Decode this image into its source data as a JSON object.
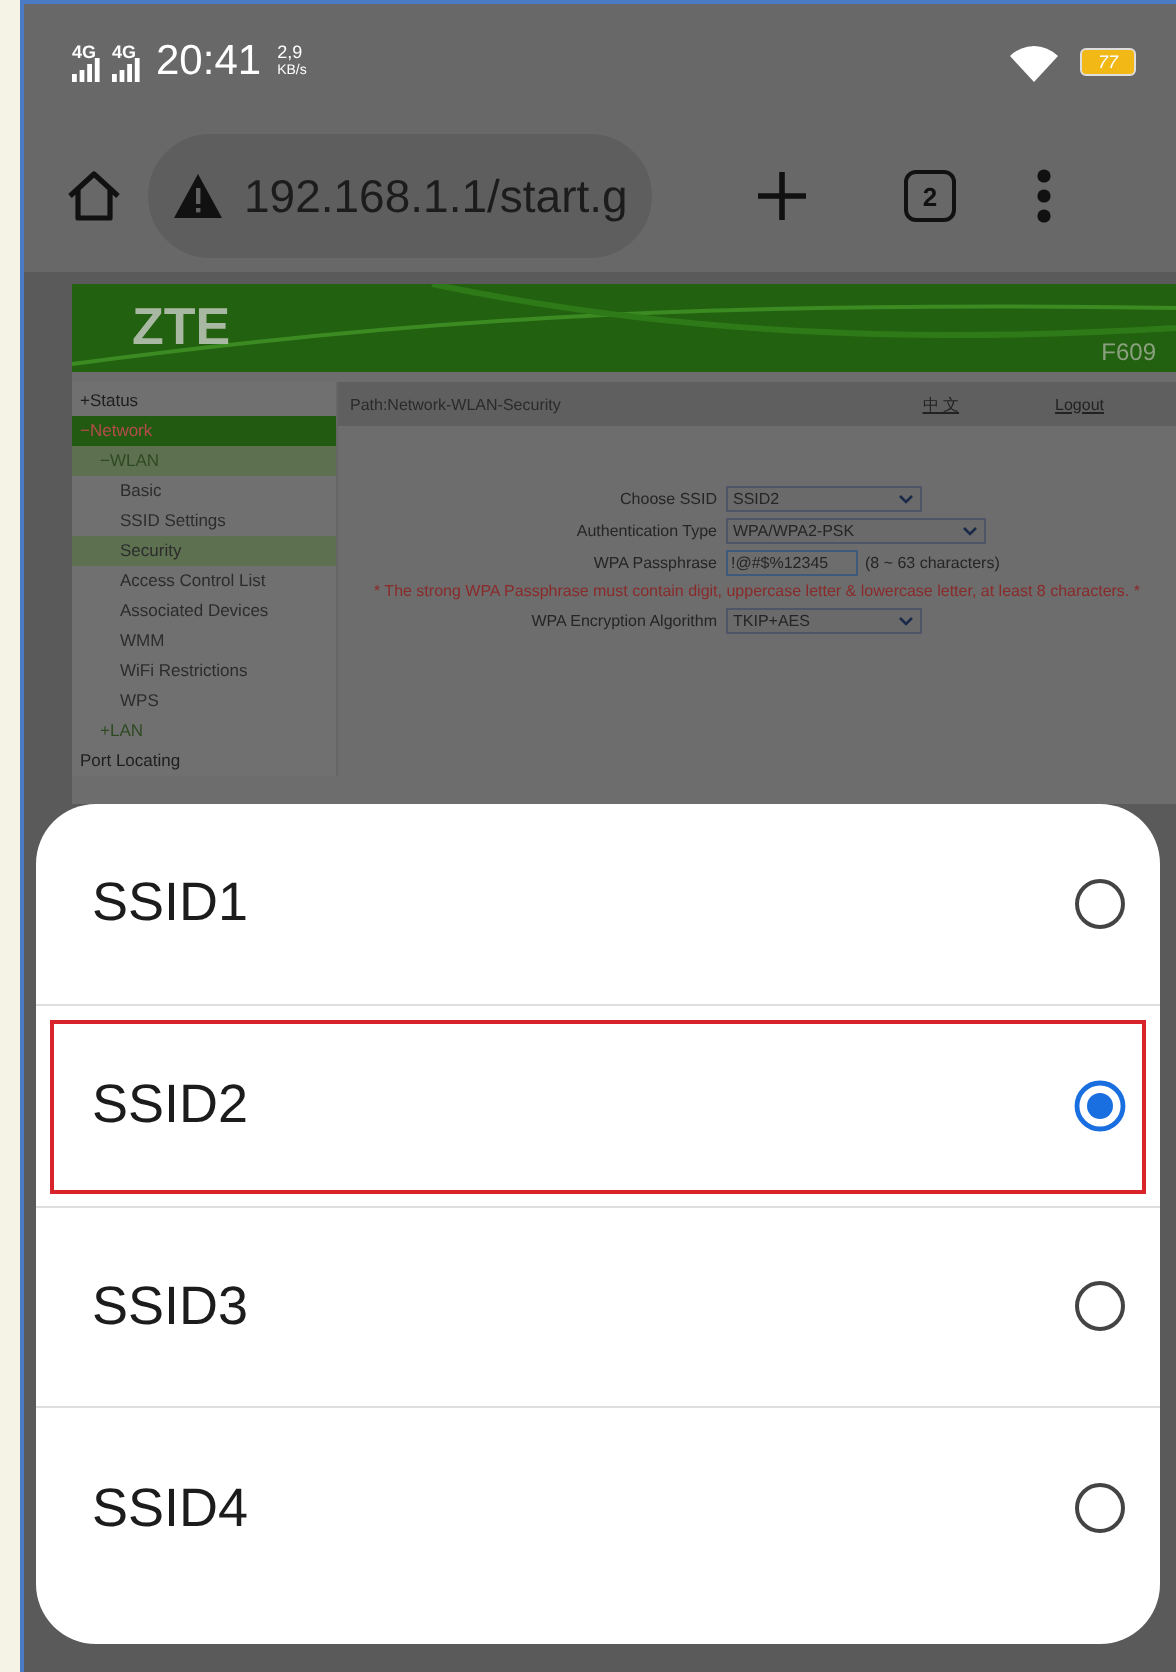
{
  "status_bar": {
    "signals": [
      {
        "label": "4G"
      },
      {
        "label": "4G"
      }
    ],
    "time": "20:41",
    "speed_value": "2,9",
    "speed_unit": "KB/s",
    "battery": "77"
  },
  "browser": {
    "url": "192.168.1.1/start.g",
    "tab_count": "2"
  },
  "router_page": {
    "brand": "ZTE",
    "model": "F609",
    "path": "Path:Network-WLAN-Security",
    "language": "中 文",
    "logout": "Logout",
    "sidebar": [
      {
        "label": "+Status",
        "open": false
      },
      {
        "label": "−Network",
        "open": true,
        "children": [
          {
            "label": "−WLAN",
            "open": true,
            "children": [
              {
                "label": "Basic",
                "selected": false
              },
              {
                "label": "SSID Settings",
                "selected": false
              },
              {
                "label": "Security",
                "selected": true
              },
              {
                "label": "Access Control List",
                "selected": false
              },
              {
                "label": "Associated Devices",
                "selected": false
              },
              {
                "label": "WMM",
                "selected": false
              },
              {
                "label": "WiFi Restrictions",
                "selected": false
              },
              {
                "label": "WPS",
                "selected": false
              }
            ]
          },
          {
            "label": "+LAN",
            "open": false
          }
        ]
      },
      {
        "label": "Port Locating",
        "open": false
      }
    ],
    "form": [
      {
        "kind": "select",
        "label": "Choose SSID",
        "value": "SSID2"
      },
      {
        "kind": "select",
        "label": "Authentication Type",
        "value": "WPA/WPA2-PSK"
      },
      {
        "kind": "text",
        "label": "WPA Passphrase",
        "value": "!@#$%12345",
        "hint": "(8 ~ 63 characters)"
      },
      {
        "kind": "warning",
        "text": "* The strong WPA Passphrase must contain digit, uppercase letter & lowercase letter, at least 8 characters. *"
      },
      {
        "kind": "select",
        "label": "WPA Encryption Algorithm",
        "value": "TKIP+AES"
      }
    ]
  },
  "dialog": {
    "options": [
      {
        "label": "SSID1",
        "selected": false,
        "highlighted": false
      },
      {
        "label": "SSID2",
        "selected": true,
        "highlighted": true
      },
      {
        "label": "SSID3",
        "selected": false,
        "highlighted": false
      },
      {
        "label": "SSID4",
        "selected": false,
        "highlighted": false
      }
    ]
  }
}
